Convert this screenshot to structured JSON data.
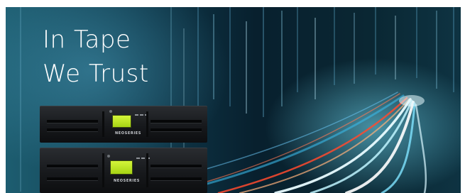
{
  "headline": {
    "line1": "In Tape",
    "line2": "We Trust"
  },
  "library_units": [
    {
      "brand": "NEOSERIES"
    },
    {
      "brand": "NEOSERIES"
    }
  ],
  "colors": {
    "background_dark": "#08202e",
    "light_streak": "#e8fbff",
    "red_streak": "#ff4a2e",
    "lcd_green": "#c6ea2a"
  }
}
